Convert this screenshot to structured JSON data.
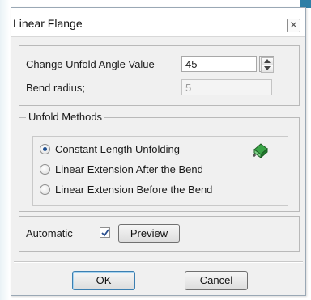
{
  "dialog": {
    "title": "Linear Flange",
    "close_icon": "close-icon"
  },
  "angle_group": {
    "unfold_angle_label": "Change Unfold Angle Value",
    "unfold_angle_value": "45",
    "bend_radius_label": "Bend radius;",
    "bend_radius_value": "5"
  },
  "unfold_methods": {
    "legend": "Unfold Methods",
    "options": [
      {
        "label": "Constant Length Unfolding",
        "selected": true
      },
      {
        "label": "Linear Extension After the Bend",
        "selected": false
      },
      {
        "label": "Linear Extension Before the Bend",
        "selected": false
      }
    ],
    "icon": "sheet-metal-flange-icon"
  },
  "preview_group": {
    "automatic_label": "Automatic",
    "automatic_checked": true,
    "preview_button": "Preview"
  },
  "footer": {
    "ok_button": "OK",
    "cancel_button": "Cancel"
  },
  "colors": {
    "dialog_background": "#f0f0f0",
    "radio_selected": "#1f4f8f",
    "icon_green": "#2e8b3a"
  }
}
